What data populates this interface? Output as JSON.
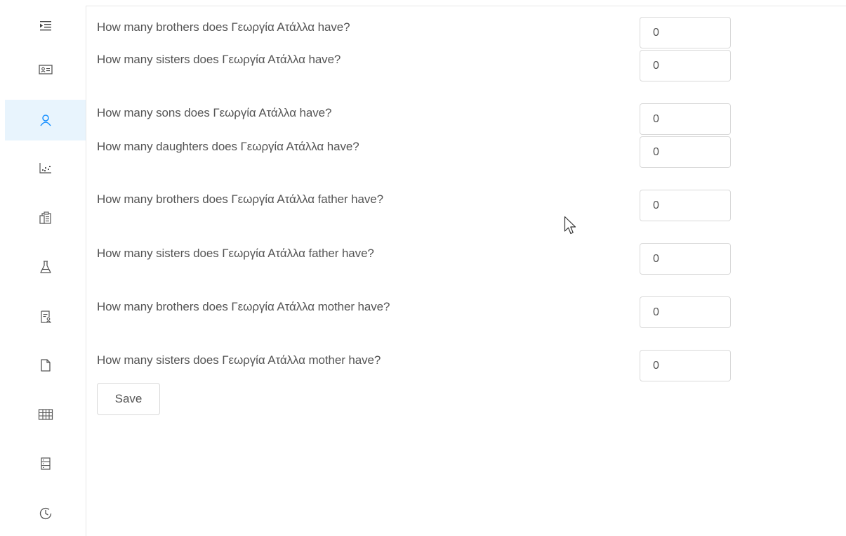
{
  "sidebar": {
    "items": [
      {
        "icon": "menu-indent-icon",
        "active": false
      },
      {
        "icon": "id-card-icon",
        "active": false
      },
      {
        "icon": "user-icon",
        "active": true
      },
      {
        "icon": "dot-chart-icon",
        "active": false
      },
      {
        "icon": "clipboard-icon",
        "active": false
      },
      {
        "icon": "flask-icon",
        "active": false
      },
      {
        "icon": "file-user-icon",
        "active": false
      },
      {
        "icon": "file-icon",
        "active": false
      },
      {
        "icon": "table-icon",
        "active": false
      },
      {
        "icon": "database-icon",
        "active": false
      },
      {
        "icon": "history-icon",
        "active": false
      }
    ],
    "active_color": "#1890ff"
  },
  "form": {
    "questions": [
      {
        "label": "How many brothers does Γεωργία Ατάλλα have?",
        "value": "0"
      },
      {
        "label": "How many sisters does Γεωργία Ατάλλα have?",
        "value": "0"
      },
      {
        "label": "How many sons does Γεωργία Ατάλλα have?",
        "value": "0"
      },
      {
        "label": "How many daughters does Γεωργία Ατάλλα have?",
        "value": "0"
      },
      {
        "label": "How many brothers does Γεωργία Ατάλλα father have?",
        "value": "0"
      },
      {
        "label": "How many sisters does Γεωργία Ατάλλα father have?",
        "value": "0"
      },
      {
        "label": "How many brothers does Γεωργία Ατάλλα mother have?",
        "value": "0"
      },
      {
        "label": "How many sisters does Γεωργία Ατάλλα mother have?",
        "value": "0"
      }
    ],
    "save_label": "Save"
  }
}
